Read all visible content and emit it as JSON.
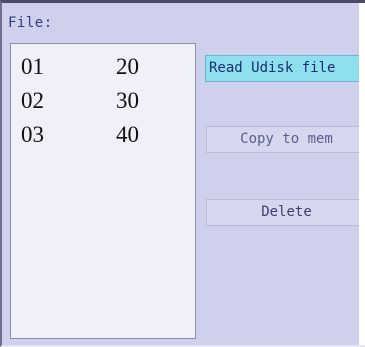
{
  "header": {
    "file_label": "File:"
  },
  "files": [
    {
      "number": "01",
      "value": "20"
    },
    {
      "number": "02",
      "value": "30"
    },
    {
      "number": "03",
      "value": "40"
    }
  ],
  "actions": {
    "read_label": "Read Udisk file",
    "copy_label": "Copy to mem",
    "delete_label": "Delete"
  },
  "colors": {
    "screen_background": "#cfd0ec",
    "list_background": "#f0f0f8",
    "highlight_button": "#8fe0ef",
    "label_text": "#2f3c86"
  }
}
